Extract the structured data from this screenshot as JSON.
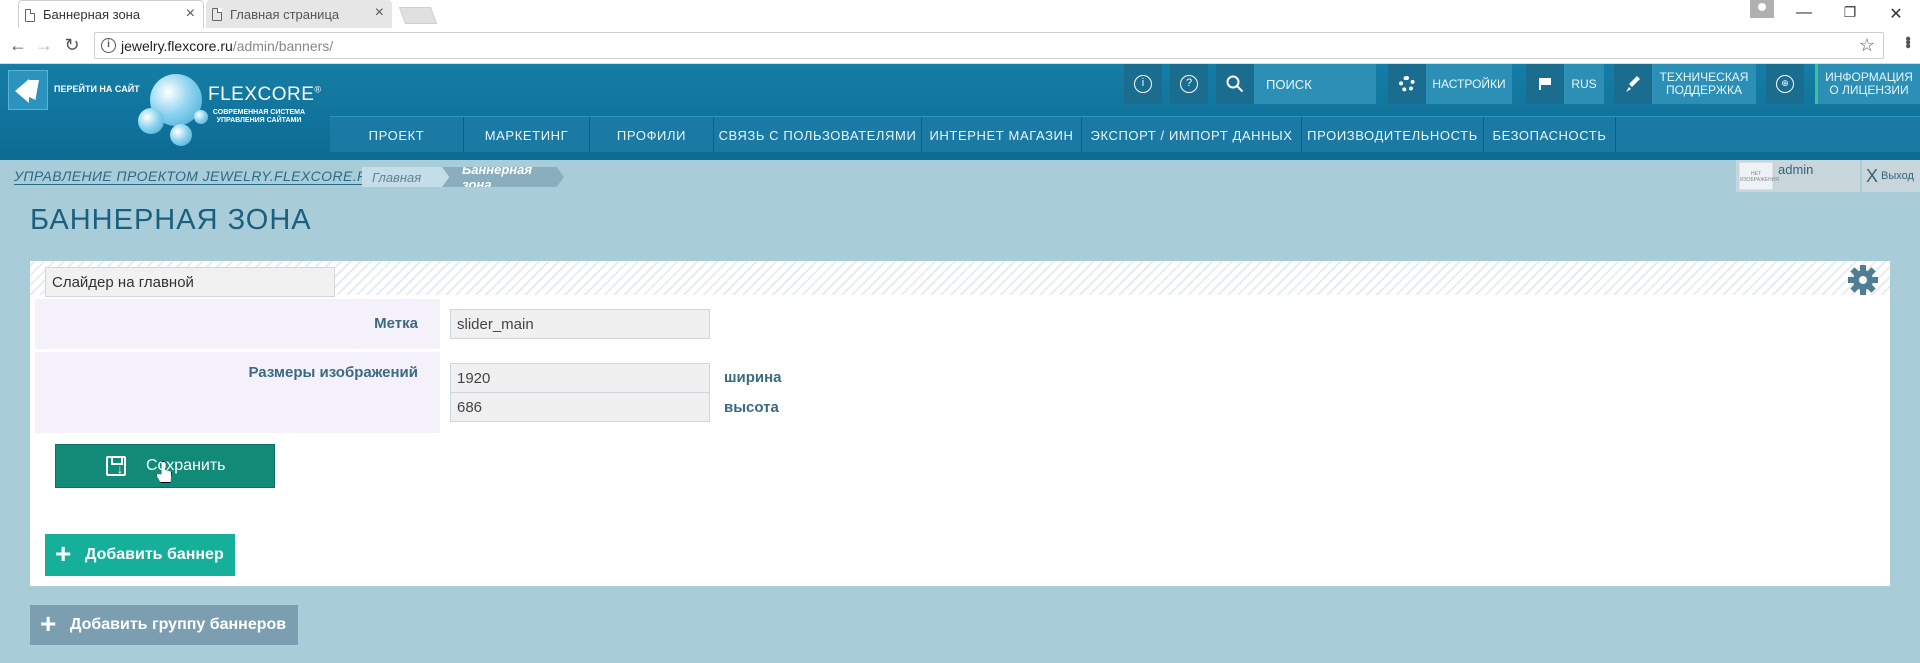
{
  "browser": {
    "tabs": [
      {
        "title": "Баннерная зона",
        "active": true
      },
      {
        "title": "Главная страница",
        "active": false
      }
    ],
    "url_host": "jewelry.flexcore.ru",
    "url_path": "/admin/banners/"
  },
  "header": {
    "site_link_label": "ПЕРЕЙТИ НА САЙТ",
    "brand": "FLEXCORE",
    "brand_mark": "®",
    "brand_sub": "СОВРЕМЕННАЯ СИСТЕМА УПРАВЛЕНИЯ САЙТАМИ",
    "search_placeholder": "ПОИСК",
    "settings_label": "НАСТРОЙКИ",
    "lang_label": "RUS",
    "support_label_1": "ТЕХНИЧЕСКАЯ",
    "support_label_2": "ПОДДЕРЖКА",
    "license_label_1": "ИНФОРМАЦИЯ",
    "license_label_2": "О ЛИЦЕНЗИИ",
    "info_icon_glyph": "i",
    "help_icon_glyph": "?"
  },
  "mainnav": {
    "items": [
      "ПРОЕКТ",
      "МАРКЕТИНГ",
      "ПРОФИЛИ",
      "СВЯЗЬ С ПОЛЬЗОВАТЕЛЯМИ",
      "ИНТЕРНЕТ МАГАЗИН",
      "ЭКСПОРТ / ИМПОРТ ДАННЫХ",
      "ПРОИЗВОДИТЕЛЬНОСТЬ",
      "БЕЗОПАСНОСТЬ"
    ]
  },
  "breadcrumb": {
    "project": "УПРАВЛЕНИЕ ПРОЕКТОМ JEWELRY.FLEXCORE.RU",
    "home": "Главная",
    "current": "Баннерная зона"
  },
  "user": {
    "name": "admin",
    "avatar_text": "НЕТ ИЗОБРАЖЕНИЯ",
    "logout_label": "Выход"
  },
  "page": {
    "title": "БАННЕРНАЯ ЗОНА",
    "group_name": "Слайдер на главной",
    "label_tag": "Метка",
    "tag_value": "slider_main",
    "label_sizes": "Размеры изображений",
    "width_value": "1920",
    "width_unit": "ширина",
    "height_value": "686",
    "height_unit": "высота",
    "save_label": "Сохранить",
    "add_banner_label": "Добавить баннер",
    "add_group_label": "Добавить группу баннеров"
  },
  "colors": {
    "header_bg": "#157ea6",
    "page_bg": "#a9cdd8",
    "save_btn": "#128a78",
    "add_btn": "#16b09a",
    "add_group_btn": "#7b9fb1",
    "accent_green": "#3cc48e"
  }
}
